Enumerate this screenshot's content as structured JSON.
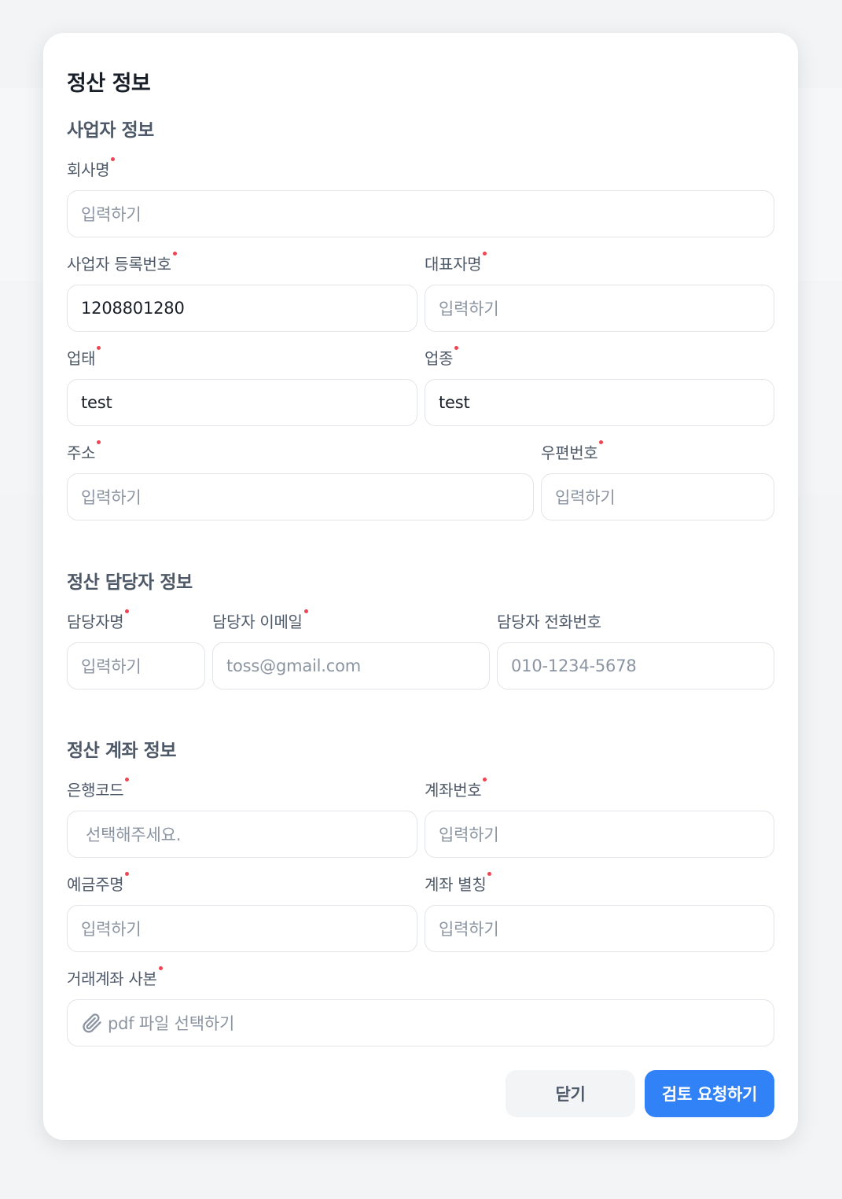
{
  "modal": {
    "title": "정산 정보",
    "close_label": "닫기",
    "submit_label": "검토 요청하기"
  },
  "business": {
    "section_title": "사업자 정보",
    "company_name": {
      "label": "회사명",
      "placeholder": "입력하기",
      "value": ""
    },
    "business_reg_number": {
      "label": "사업자 등록번호",
      "placeholder": "입력하기",
      "value": "1208801280"
    },
    "ceo_name": {
      "label": "대표자명",
      "placeholder": "입력하기",
      "value": ""
    },
    "business_type": {
      "label": "업태",
      "placeholder": "입력하기",
      "value": "test"
    },
    "business_item": {
      "label": "업종",
      "placeholder": "입력하기",
      "value": "test"
    },
    "address": {
      "label": "주소",
      "placeholder": "입력하기",
      "value": ""
    },
    "postal_code": {
      "label": "우편번호",
      "placeholder": "입력하기",
      "value": ""
    }
  },
  "manager": {
    "section_title": "정산 담당자 정보",
    "name": {
      "label": "담당자명",
      "placeholder": "입력하기",
      "value": ""
    },
    "email": {
      "label": "담당자 이메일",
      "placeholder": "toss@gmail.com",
      "value": ""
    },
    "phone": {
      "label": "담당자 전화번호",
      "placeholder": "010-1234-5678",
      "value": ""
    }
  },
  "account": {
    "section_title": "정산 계좌 정보",
    "bank_code": {
      "label": "은행코드",
      "placeholder": "선택해주세요.",
      "value": ""
    },
    "account_number": {
      "label": "계좌번호",
      "placeholder": "입력하기",
      "value": ""
    },
    "holder_name": {
      "label": "예금주명",
      "placeholder": "입력하기",
      "value": ""
    },
    "account_alias": {
      "label": "계좌 별칭",
      "placeholder": "입력하기",
      "value": ""
    },
    "bankbook_copy": {
      "label": "거래계좌 사본",
      "placeholder": "pdf 파일 선택하기"
    }
  },
  "icons": {
    "file_attach": "paperclip-icon"
  },
  "colors": {
    "primary": "#3182f6",
    "required_dot": "#f04452"
  }
}
